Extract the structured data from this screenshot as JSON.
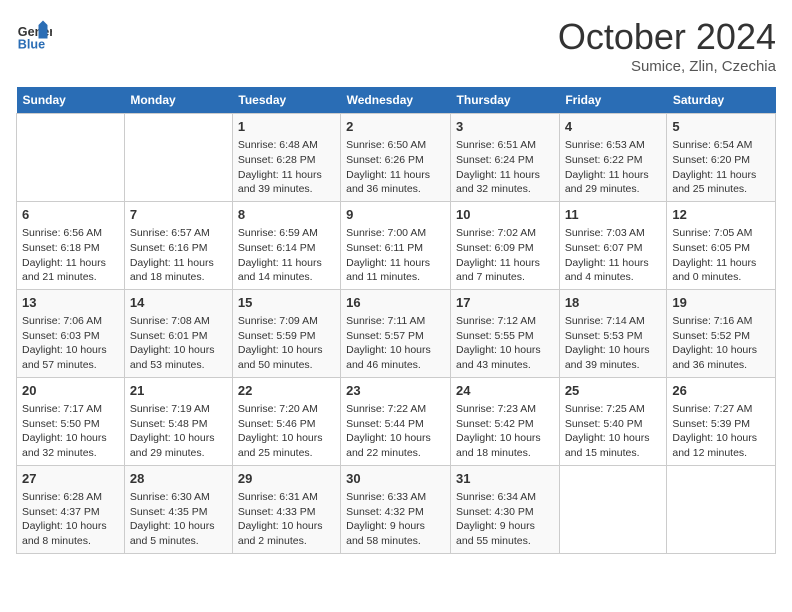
{
  "header": {
    "logo_line1": "General",
    "logo_line2": "Blue",
    "month": "October 2024",
    "location": "Sumice, Zlin, Czechia"
  },
  "days_of_week": [
    "Sunday",
    "Monday",
    "Tuesday",
    "Wednesday",
    "Thursday",
    "Friday",
    "Saturday"
  ],
  "weeks": [
    [
      {
        "day": "",
        "info": ""
      },
      {
        "day": "",
        "info": ""
      },
      {
        "day": "1",
        "info": "Sunrise: 6:48 AM\nSunset: 6:28 PM\nDaylight: 11 hours and 39 minutes."
      },
      {
        "day": "2",
        "info": "Sunrise: 6:50 AM\nSunset: 6:26 PM\nDaylight: 11 hours and 36 minutes."
      },
      {
        "day": "3",
        "info": "Sunrise: 6:51 AM\nSunset: 6:24 PM\nDaylight: 11 hours and 32 minutes."
      },
      {
        "day": "4",
        "info": "Sunrise: 6:53 AM\nSunset: 6:22 PM\nDaylight: 11 hours and 29 minutes."
      },
      {
        "day": "5",
        "info": "Sunrise: 6:54 AM\nSunset: 6:20 PM\nDaylight: 11 hours and 25 minutes."
      }
    ],
    [
      {
        "day": "6",
        "info": "Sunrise: 6:56 AM\nSunset: 6:18 PM\nDaylight: 11 hours and 21 minutes."
      },
      {
        "day": "7",
        "info": "Sunrise: 6:57 AM\nSunset: 6:16 PM\nDaylight: 11 hours and 18 minutes."
      },
      {
        "day": "8",
        "info": "Sunrise: 6:59 AM\nSunset: 6:14 PM\nDaylight: 11 hours and 14 minutes."
      },
      {
        "day": "9",
        "info": "Sunrise: 7:00 AM\nSunset: 6:11 PM\nDaylight: 11 hours and 11 minutes."
      },
      {
        "day": "10",
        "info": "Sunrise: 7:02 AM\nSunset: 6:09 PM\nDaylight: 11 hours and 7 minutes."
      },
      {
        "day": "11",
        "info": "Sunrise: 7:03 AM\nSunset: 6:07 PM\nDaylight: 11 hours and 4 minutes."
      },
      {
        "day": "12",
        "info": "Sunrise: 7:05 AM\nSunset: 6:05 PM\nDaylight: 11 hours and 0 minutes."
      }
    ],
    [
      {
        "day": "13",
        "info": "Sunrise: 7:06 AM\nSunset: 6:03 PM\nDaylight: 10 hours and 57 minutes."
      },
      {
        "day": "14",
        "info": "Sunrise: 7:08 AM\nSunset: 6:01 PM\nDaylight: 10 hours and 53 minutes."
      },
      {
        "day": "15",
        "info": "Sunrise: 7:09 AM\nSunset: 5:59 PM\nDaylight: 10 hours and 50 minutes."
      },
      {
        "day": "16",
        "info": "Sunrise: 7:11 AM\nSunset: 5:57 PM\nDaylight: 10 hours and 46 minutes."
      },
      {
        "day": "17",
        "info": "Sunrise: 7:12 AM\nSunset: 5:55 PM\nDaylight: 10 hours and 43 minutes."
      },
      {
        "day": "18",
        "info": "Sunrise: 7:14 AM\nSunset: 5:53 PM\nDaylight: 10 hours and 39 minutes."
      },
      {
        "day": "19",
        "info": "Sunrise: 7:16 AM\nSunset: 5:52 PM\nDaylight: 10 hours and 36 minutes."
      }
    ],
    [
      {
        "day": "20",
        "info": "Sunrise: 7:17 AM\nSunset: 5:50 PM\nDaylight: 10 hours and 32 minutes."
      },
      {
        "day": "21",
        "info": "Sunrise: 7:19 AM\nSunset: 5:48 PM\nDaylight: 10 hours and 29 minutes."
      },
      {
        "day": "22",
        "info": "Sunrise: 7:20 AM\nSunset: 5:46 PM\nDaylight: 10 hours and 25 minutes."
      },
      {
        "day": "23",
        "info": "Sunrise: 7:22 AM\nSunset: 5:44 PM\nDaylight: 10 hours and 22 minutes."
      },
      {
        "day": "24",
        "info": "Sunrise: 7:23 AM\nSunset: 5:42 PM\nDaylight: 10 hours and 18 minutes."
      },
      {
        "day": "25",
        "info": "Sunrise: 7:25 AM\nSunset: 5:40 PM\nDaylight: 10 hours and 15 minutes."
      },
      {
        "day": "26",
        "info": "Sunrise: 7:27 AM\nSunset: 5:39 PM\nDaylight: 10 hours and 12 minutes."
      }
    ],
    [
      {
        "day": "27",
        "info": "Sunrise: 6:28 AM\nSunset: 4:37 PM\nDaylight: 10 hours and 8 minutes."
      },
      {
        "day": "28",
        "info": "Sunrise: 6:30 AM\nSunset: 4:35 PM\nDaylight: 10 hours and 5 minutes."
      },
      {
        "day": "29",
        "info": "Sunrise: 6:31 AM\nSunset: 4:33 PM\nDaylight: 10 hours and 2 minutes."
      },
      {
        "day": "30",
        "info": "Sunrise: 6:33 AM\nSunset: 4:32 PM\nDaylight: 9 hours and 58 minutes."
      },
      {
        "day": "31",
        "info": "Sunrise: 6:34 AM\nSunset: 4:30 PM\nDaylight: 9 hours and 55 minutes."
      },
      {
        "day": "",
        "info": ""
      },
      {
        "day": "",
        "info": ""
      }
    ]
  ]
}
